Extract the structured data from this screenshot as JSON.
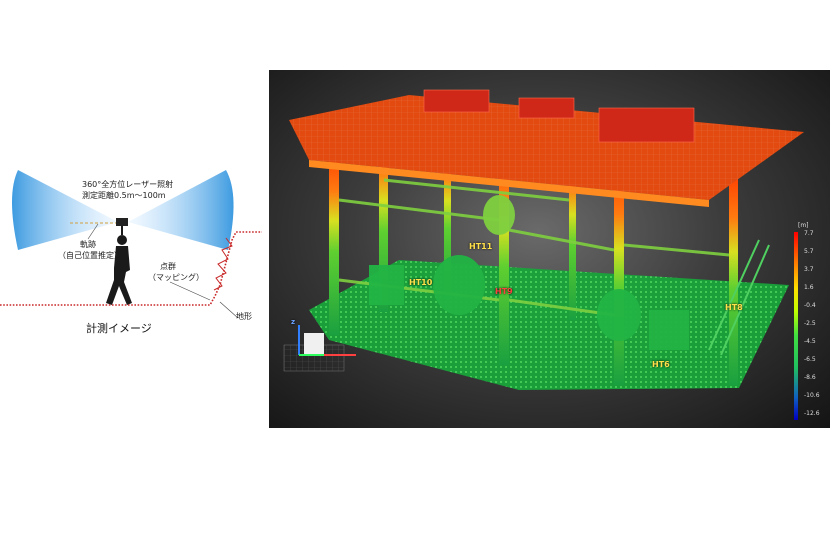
{
  "left": {
    "laser_line1": "360°全方位レーザー照射",
    "laser_line2": "測定距離0.5m～100m",
    "trajectory_line1": "軌跡",
    "trajectory_line2": "（自己位置推定）",
    "pointcloud_line1": "点群",
    "pointcloud_line2": "（マッピング）",
    "terrain": "地形",
    "caption": "計測イメージ"
  },
  "scan": {
    "tags": [
      {
        "text": "HT11",
        "color": "yellow"
      },
      {
        "text": "HT10",
        "color": "yellow"
      },
      {
        "text": "HT9",
        "color": "red"
      },
      {
        "text": "HT8",
        "color": "yellow"
      },
      {
        "text": "HT6",
        "color": "yellow"
      }
    ],
    "scale_unit": "[m]",
    "scale_ticks": [
      "7.7",
      "5.7",
      "3.7",
      "1.6",
      "-0.4",
      "-2.5",
      "-4.5",
      "-6.5",
      "-8.6",
      "-10.6",
      "-12.6"
    ],
    "axis_z": "z",
    "colors": {
      "high": "#ff2a00",
      "mid": "#e0e020",
      "low": "#1fbf3f"
    }
  }
}
